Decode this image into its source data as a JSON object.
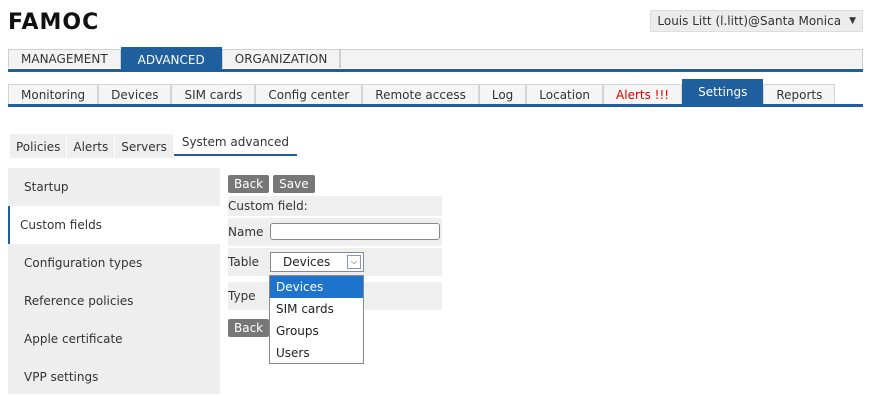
{
  "header": {
    "logo": "FAMOC",
    "user": "Louis Litt (l.litt)@Santa Monica"
  },
  "top_tabs": [
    "MANAGEMENT",
    "ADVANCED",
    "ORGANIZATION"
  ],
  "top_tab_active": "ADVANCED",
  "nav_tabs": [
    "Monitoring",
    "Devices",
    "SIM cards",
    "Config center",
    "Remote access",
    "Log",
    "Location",
    "Alerts !!!",
    "Settings",
    "Reports"
  ],
  "nav_tab_active": "Settings",
  "sub_tabs": [
    "Policies",
    "Alerts",
    "Servers",
    "System advanced"
  ],
  "sub_tab_active": "System advanced",
  "left_nav": [
    "Startup",
    "Custom fields",
    "Configuration types",
    "Reference policies",
    "Apple certificate",
    "VPP settings"
  ],
  "left_nav_active": "Custom fields",
  "form": {
    "back_label": "Back",
    "save_label": "Save",
    "title": "Custom field:",
    "name_label": "Name",
    "name_value": "",
    "table_label": "Table",
    "table_value": "Devices",
    "type_label": "Type",
    "table_options": [
      "Devices",
      "SIM cards",
      "Groups",
      "Users"
    ],
    "table_option_highlighted": "Devices"
  },
  "colors": {
    "accent": "#1f5f9e",
    "alert": "#e00000",
    "button": "#777777",
    "dropdown_highlight": "#1e73cc"
  }
}
